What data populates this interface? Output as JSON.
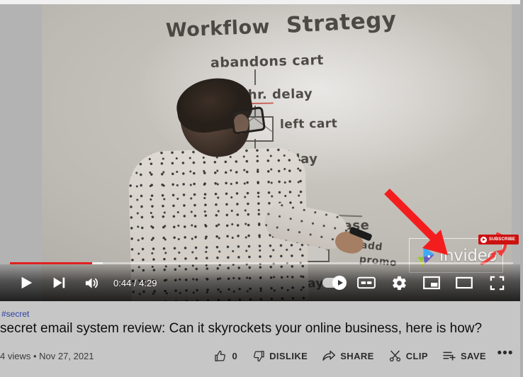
{
  "player": {
    "time_display": "0:44 / 4:29",
    "progress_percent": 16.4,
    "loaded_percent": 18.5,
    "controls": {
      "play": "play-button",
      "next": "next-video-button",
      "volume": "volume-button",
      "autoplay": "autoplay-toggle",
      "captions": "closed-captions-button",
      "settings": "settings-button",
      "miniplayer": "miniplayer-button",
      "theater": "theater-mode-button",
      "fullscreen": "fullscreen-button"
    },
    "watermark": {
      "brand": "invideo",
      "subscribe_label": "SUBSCRIBE"
    },
    "whiteboard": {
      "title_a": "Workflow",
      "title_b": "Strategy",
      "step_1": "abandons cart",
      "step_2": "1 hr. delay",
      "label_2": "left cart",
      "step_3": "1 day delay",
      "step_4": "No purchase",
      "note_a": "add",
      "note_b": "promo",
      "step_5": "1 day delay"
    }
  },
  "meta": {
    "hashtag": "#secret",
    "title": "secret email system review: Can it skyrockets your online business, here is how?",
    "views": "4 views",
    "separator": "•",
    "date": "Nov 27, 2021",
    "like_count": "0",
    "dislike_label": "DISLIKE",
    "share_label": "SHARE",
    "clip_label": "CLIP",
    "save_label": "SAVE",
    "more_label": "•••"
  },
  "colors": {
    "progress_red": "#e02020",
    "hashtag_blue": "#2b40a0",
    "subscribe_red": "#cc1111",
    "annotation_red": "#f41d1d",
    "panel_bg": "#c6c6c6"
  }
}
